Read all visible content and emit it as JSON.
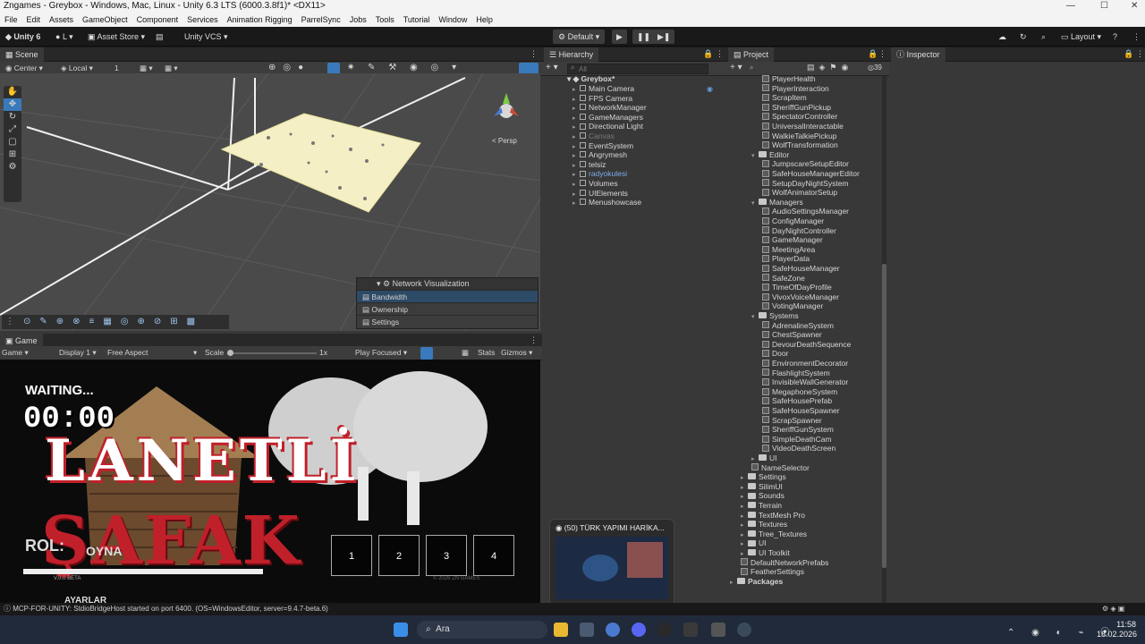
{
  "window": {
    "title": "Zngames - Greybox - Windows, Mac, Linux - Unity 6.3 LTS (6000.3.8f1)* <DX11>"
  },
  "menu": [
    "File",
    "Edit",
    "Assets",
    "GameObject",
    "Component",
    "Services",
    "Animation Rigging",
    "ParrelSync",
    "Jobs",
    "Tools",
    "Tutorial",
    "Window",
    "Help"
  ],
  "toolbar": {
    "unity_label": "Unity 6",
    "account_label": "L",
    "asset_store_label": "Asset Store",
    "vcs_label": "Unity VCS",
    "playmode_label": "Default",
    "layout_label": "Layout"
  },
  "scene": {
    "tab_label": "Scene",
    "pivot_label": "Center",
    "space_label": "Local",
    "snap_value": "1",
    "persp_label": "< Persp",
    "overlay": {
      "title": "Network Visualization",
      "items": [
        "Bandwidth",
        "Ownership",
        "Settings"
      ]
    }
  },
  "game": {
    "tab_label": "Game",
    "mode_label": "Game",
    "display_label": "Display 1",
    "aspect_label": "Free Aspect",
    "scale_label": "Scale",
    "scale_value": "1x",
    "play_focus_label": "Play Focused",
    "stats_label": "Stats",
    "gizmos_label": "Gizmos",
    "waiting_text": "WAITING...",
    "timer_text": "00:00",
    "logo_line1": "LANETLİ",
    "logo_line2": "ŞAFAK",
    "role_text": "ROL:",
    "play_text": "OYNA",
    "settings_text": "AYARLAR",
    "version_text": "V.0.0 BETA",
    "copyright_text": "© 2026 ZN GAMES",
    "slots": [
      "1",
      "2",
      "3",
      "4"
    ]
  },
  "hierarchy": {
    "tab_label": "Hierarchy",
    "search_placeholder": "All",
    "scene_name": "Greybox*",
    "items": [
      {
        "label": "Main Camera",
        "dim": false
      },
      {
        "label": "FPS Camera",
        "dim": false
      },
      {
        "label": "NetworkManager",
        "dim": false
      },
      {
        "label": "GameManagers",
        "dim": false
      },
      {
        "label": "Directional Light",
        "dim": false
      },
      {
        "label": "Canvas",
        "dim": true
      },
      {
        "label": "EventSystem",
        "dim": false
      },
      {
        "label": "Angrymesh",
        "dim": false
      },
      {
        "label": "telsiz",
        "dim": false
      },
      {
        "label": "radyokulesi",
        "dim": false
      },
      {
        "label": "Volumes",
        "dim": false
      },
      {
        "label": "UIElements",
        "dim": false
      },
      {
        "label": "Menushowcase",
        "dim": false
      }
    ]
  },
  "project": {
    "tab_label": "Project",
    "count_badge": "39",
    "rows": [
      {
        "t": "s",
        "label": "PlayerHealth",
        "d": 3
      },
      {
        "t": "s",
        "label": "PlayerInteraction",
        "d": 3
      },
      {
        "t": "s",
        "label": "ScrapItem",
        "d": 3
      },
      {
        "t": "s",
        "label": "SheriffGunPickup",
        "d": 3
      },
      {
        "t": "s",
        "label": "SpectatorController",
        "d": 3
      },
      {
        "t": "s",
        "label": "UniversalInteractable",
        "d": 3
      },
      {
        "t": "s",
        "label": "WalkieTalkiePickup",
        "d": 3
      },
      {
        "t": "s",
        "label": "WolfTransformation",
        "d": 3
      },
      {
        "t": "f",
        "label": "Editor",
        "d": 2
      },
      {
        "t": "s",
        "label": "JumpscareSetupEditor",
        "d": 3
      },
      {
        "t": "s",
        "label": "SafeHouseManagerEditor",
        "d": 3
      },
      {
        "t": "s",
        "label": "SetupDayNightSystem",
        "d": 3
      },
      {
        "t": "s",
        "label": "WolfAnimatorSetup",
        "d": 3
      },
      {
        "t": "f",
        "label": "Managers",
        "d": 2
      },
      {
        "t": "s",
        "label": "AudioSettingsManager",
        "d": 3
      },
      {
        "t": "s",
        "label": "ConfigManager",
        "d": 3
      },
      {
        "t": "s",
        "label": "DayNightController",
        "d": 3
      },
      {
        "t": "s",
        "label": "GameManager",
        "d": 3
      },
      {
        "t": "s",
        "label": "MeetingArea",
        "d": 3
      },
      {
        "t": "s",
        "label": "PlayerData",
        "d": 3
      },
      {
        "t": "s",
        "label": "SafeHouseManager",
        "d": 3
      },
      {
        "t": "s",
        "label": "SafeZone",
        "d": 3
      },
      {
        "t": "s",
        "label": "TimeOfDayProfile",
        "d": 3
      },
      {
        "t": "s",
        "label": "VivoxVoiceManager",
        "d": 3
      },
      {
        "t": "s",
        "label": "VotingManager",
        "d": 3
      },
      {
        "t": "f",
        "label": "Systems",
        "d": 2
      },
      {
        "t": "s",
        "label": "AdrenalineSystem",
        "d": 3
      },
      {
        "t": "s",
        "label": "ChestSpawner",
        "d": 3
      },
      {
        "t": "s",
        "label": "DevourDeathSequence",
        "d": 3
      },
      {
        "t": "s",
        "label": "Door",
        "d": 3
      },
      {
        "t": "s",
        "label": "EnvironmentDecorator",
        "d": 3
      },
      {
        "t": "s",
        "label": "FlashlightSystem",
        "d": 3
      },
      {
        "t": "s",
        "label": "InvisibleWallGenerator",
        "d": 3
      },
      {
        "t": "s",
        "label": "MegaphoneSystem",
        "d": 3
      },
      {
        "t": "s",
        "label": "SafeHousePrefab",
        "d": 3
      },
      {
        "t": "s",
        "label": "SafeHouseSpawner",
        "d": 3
      },
      {
        "t": "s",
        "label": "ScrapSpawner",
        "d": 3
      },
      {
        "t": "s",
        "label": "SheriffGunSystem",
        "d": 3
      },
      {
        "t": "s",
        "label": "SimpleDeathCam",
        "d": 3
      },
      {
        "t": "s",
        "label": "VideoDeathScreen",
        "d": 3
      },
      {
        "t": "f",
        "label": "UI",
        "d": 2
      },
      {
        "t": "s",
        "label": "NameSelector",
        "d": 2
      },
      {
        "t": "f",
        "label": "Settings",
        "d": 1
      },
      {
        "t": "f",
        "label": "SilimUI",
        "d": 1
      },
      {
        "t": "f",
        "label": "Sounds",
        "d": 1
      },
      {
        "t": "f",
        "label": "Terrain",
        "d": 1
      },
      {
        "t": "f",
        "label": "TextMesh Pro",
        "d": 1
      },
      {
        "t": "f",
        "label": "Textures",
        "d": 1
      },
      {
        "t": "f",
        "label": "Tree_Textures",
        "d": 1
      },
      {
        "t": "f",
        "label": "UI",
        "d": 1
      },
      {
        "t": "f",
        "label": "UI Toolkit",
        "d": 1
      },
      {
        "t": "s",
        "label": "DefaultNetworkPrefabs",
        "d": 1
      },
      {
        "t": "s",
        "label": "FeatherSettings",
        "d": 1
      },
      {
        "t": "f",
        "label": "Packages",
        "d": 0
      }
    ]
  },
  "inspector": {
    "tab_label": "Inspector"
  },
  "browser_preview": {
    "title": "(50) TÜRK YAPIMI HARİKA..."
  },
  "status": {
    "message": "MCP-FOR-UNITY: StdioBridgeHost started on port 6400. (OS=WindowsEditor, server=9.4.7-beta.6)"
  },
  "taskbar": {
    "search_label": "Ara",
    "time": "11:58",
    "date": "18.02.2026"
  },
  "colors": {
    "accent_blue": "#3a79bb",
    "logo_red": "#c0202a",
    "taskbar_bg": "#202a3a"
  }
}
